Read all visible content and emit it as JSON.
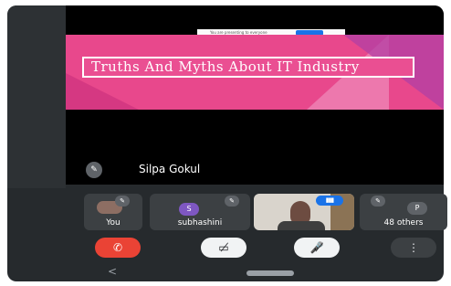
{
  "slide": {
    "title": "Truths And Myths About IT Industry",
    "topbar_text": "You are presenting to everyone"
  },
  "speaker": {
    "name": "Silpa Gokul",
    "mic_icon": "mic-off-icon"
  },
  "participants": [
    {
      "label": "You",
      "icon": "mic-off-icon"
    },
    {
      "label": "subhashini",
      "avatar": "S",
      "icon": "mic-off-icon"
    },
    {
      "label": "",
      "icon": "audio-indicator-icon",
      "indicator": "▮▮▮"
    },
    {
      "label": "48 others",
      "avatar": "P",
      "icon": "mic-off-icon"
    }
  ],
  "controls": {
    "end": "✆",
    "camera": "▭̸",
    "mic": "🎤̸",
    "more": "⋮"
  },
  "nav": {
    "back": "<"
  },
  "colors": {
    "end_call": "#ea4335",
    "slide_pink": "#e8488c",
    "speaking_blue": "#1a73e8"
  }
}
